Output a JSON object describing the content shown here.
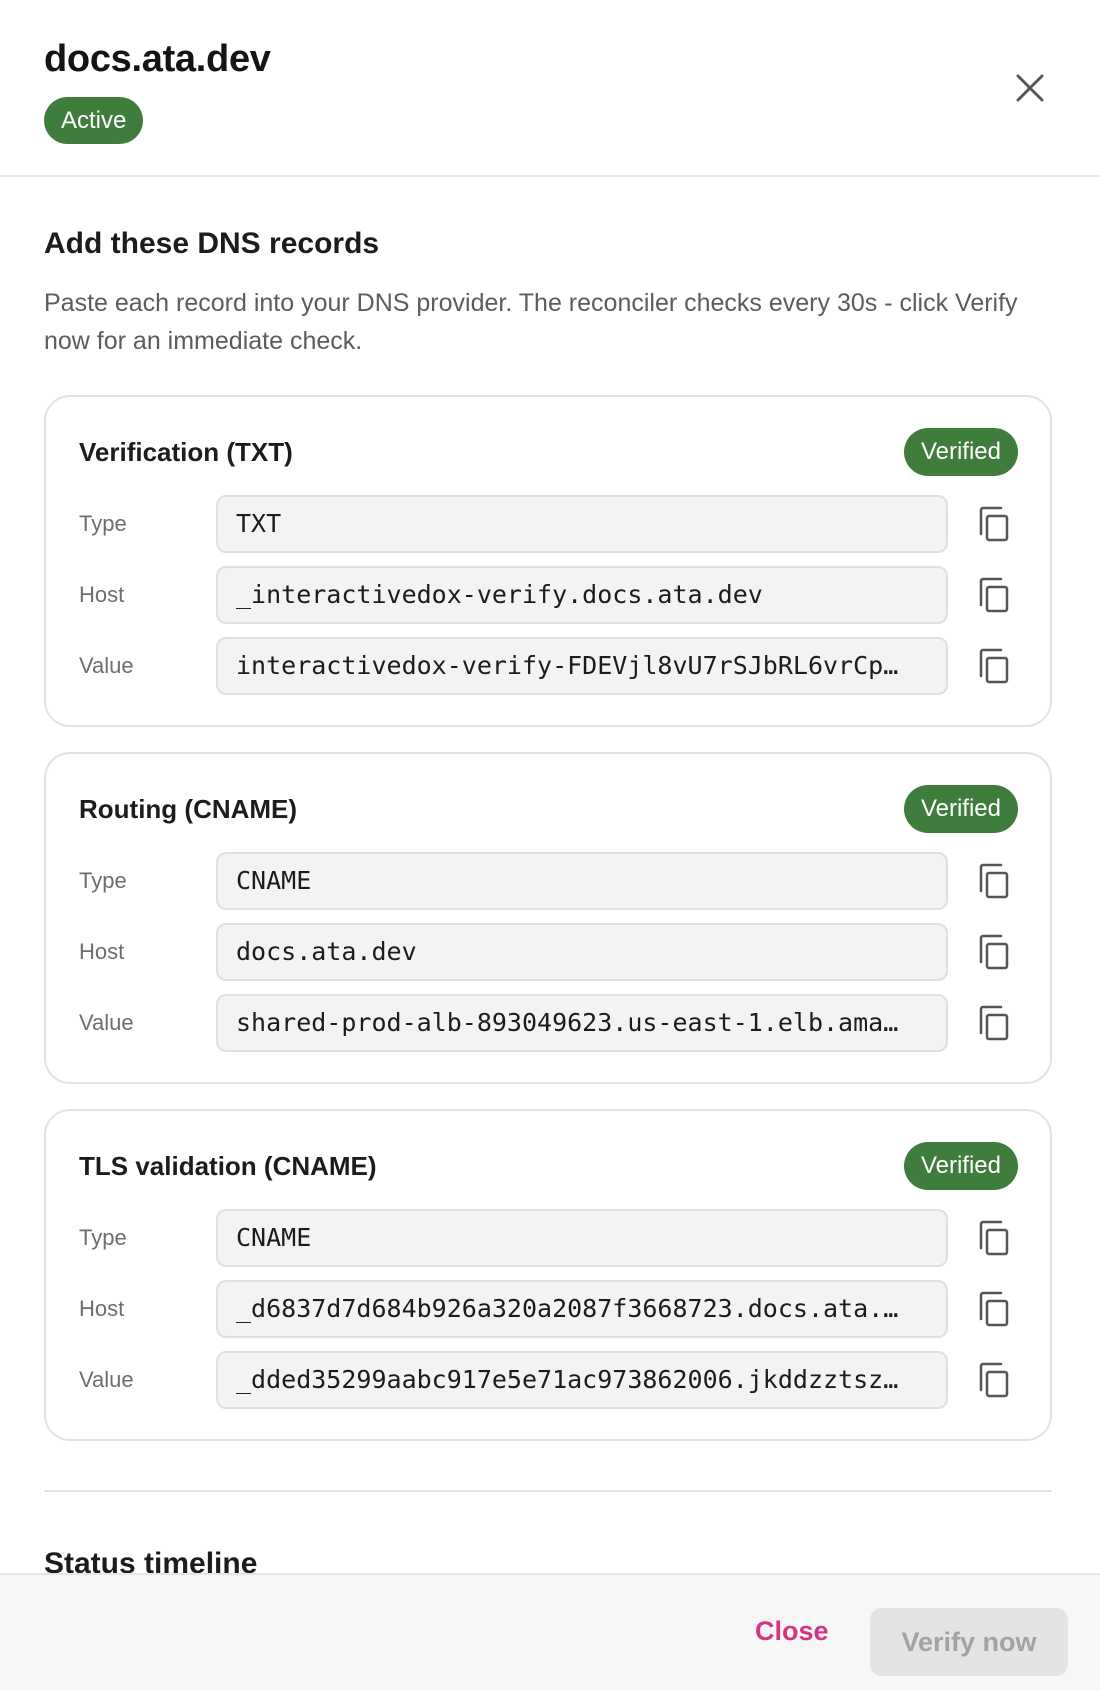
{
  "header": {
    "title": "docs.ata.dev",
    "status": "Active",
    "status_color": "#3e7d3b",
    "close_icon": "close-icon"
  },
  "section": {
    "title": "Add these DNS records",
    "description": "Paste each record into your DNS provider. The reconciler checks every 30s - click Verify now for an immediate check."
  },
  "records": [
    {
      "title": "Verification (TXT)",
      "status": "Verified",
      "rows": [
        {
          "label": "Type",
          "value": "TXT"
        },
        {
          "label": "Host",
          "value": "_interactivedox-verify.docs.ata.dev"
        },
        {
          "label": "Value",
          "value": "interactivedox-verify-FDEVjl8vU7rSJbRL6vrCp…"
        }
      ]
    },
    {
      "title": "Routing (CNAME)",
      "status": "Verified",
      "rows": [
        {
          "label": "Type",
          "value": "CNAME"
        },
        {
          "label": "Host",
          "value": "docs.ata.dev"
        },
        {
          "label": "Value",
          "value": "shared-prod-alb-893049623.us-east-1.elb.ama…"
        }
      ]
    },
    {
      "title": "TLS validation (CNAME)",
      "status": "Verified",
      "rows": [
        {
          "label": "Type",
          "value": "CNAME"
        },
        {
          "label": "Host",
          "value": "_d6837d7d684b926a320a2087f3668723.docs.ata.…"
        },
        {
          "label": "Value",
          "value": "_dded35299aabc917e5e71ac973862006.jkddzztsz…"
        }
      ]
    }
  ],
  "copy_icon": "copy-icon",
  "timeline": {
    "title": "Status timeline"
  },
  "footer": {
    "close_label": "Close",
    "verify_label": "Verify now",
    "close_color": "#d63384"
  }
}
